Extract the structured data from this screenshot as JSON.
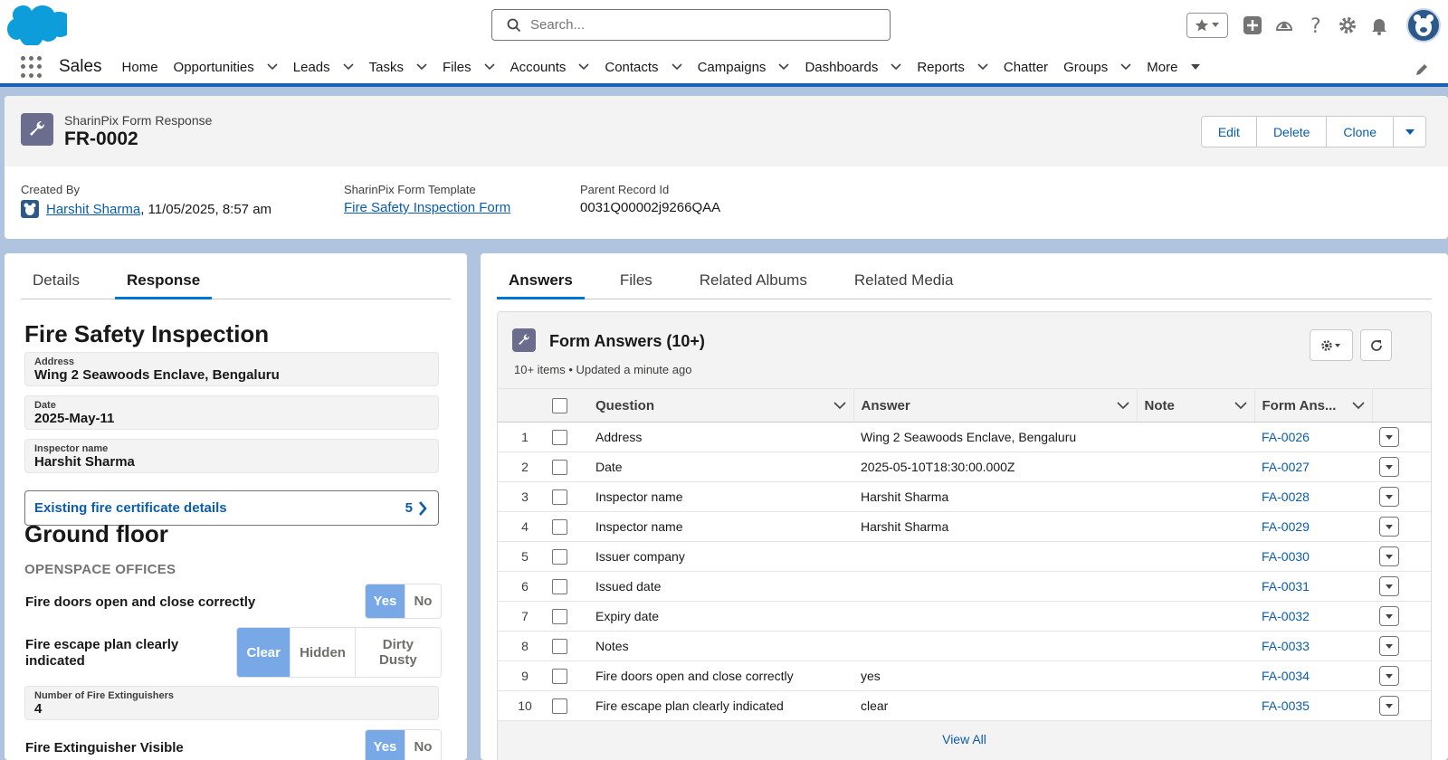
{
  "header": {
    "search_placeholder": "Search...",
    "app_name": "Sales",
    "nav": [
      {
        "label": "Home",
        "dropdown": false
      },
      {
        "label": "Opportunities",
        "dropdown": true
      },
      {
        "label": "Leads",
        "dropdown": true
      },
      {
        "label": "Tasks",
        "dropdown": true
      },
      {
        "label": "Files",
        "dropdown": true
      },
      {
        "label": "Accounts",
        "dropdown": true
      },
      {
        "label": "Contacts",
        "dropdown": true
      },
      {
        "label": "Campaigns",
        "dropdown": true
      },
      {
        "label": "Dashboards",
        "dropdown": true
      },
      {
        "label": "Reports",
        "dropdown": true
      },
      {
        "label": "Chatter",
        "dropdown": false
      },
      {
        "label": "Groups",
        "dropdown": true
      },
      {
        "label": "More",
        "dropdown": true
      }
    ]
  },
  "record": {
    "object_label": "SharinPix Form Response",
    "name": "FR-0002",
    "actions": {
      "edit": "Edit",
      "delete": "Delete",
      "clone": "Clone"
    },
    "created_by_label": "Created By",
    "created_by_user": "Harshit Sharma",
    "created_by_date": ", 11/05/2025, 8:57 am",
    "template_label": "SharinPix Form Template",
    "template_value": "Fire Safety Inspection Form",
    "parent_label": "Parent Record Id",
    "parent_value": "0031Q00002j9266QAA"
  },
  "left": {
    "tabs": [
      "Details",
      "Response"
    ],
    "active_tab": "Response",
    "form_title": "Fire Safety Inspection",
    "fields": [
      {
        "label": "Address",
        "value": "Wing 2 Seawoods Enclave, Bengaluru"
      },
      {
        "label": "Date",
        "value": "2025-May-11"
      },
      {
        "label": "Inspector name",
        "value": "Harshit Sharma"
      }
    ],
    "link_section": {
      "label": "Existing fire certificate details",
      "count": "5"
    },
    "section_title": "Ground floor",
    "section_subtitle": "OPENSPACE OFFICES",
    "q1": {
      "label": "Fire doors open and close correctly",
      "options": [
        "Yes",
        "No"
      ],
      "selected": "Yes"
    },
    "q2": {
      "label": "Fire escape plan clearly indicated",
      "options": [
        "Clear",
        "Hidden",
        "Dirty Dusty"
      ],
      "selected": "Clear"
    },
    "extinguishers": {
      "label": "Number of Fire Extinguishers",
      "value": "4"
    },
    "q3": {
      "label": "Fire Extinguisher Visible",
      "options": [
        "Yes",
        "No"
      ],
      "selected": "Yes"
    }
  },
  "right": {
    "tabs": [
      "Answers",
      "Files",
      "Related Albums",
      "Related Media"
    ],
    "active_tab": "Answers",
    "list_title": "Form Answers (10+)",
    "list_meta": "10+ items • Updated a minute ago",
    "columns": [
      "Question",
      "Answer",
      "Note",
      "Form Ans..."
    ],
    "rows": [
      {
        "n": "1",
        "question": "Address",
        "answer": "Wing 2 Seawoods Enclave, Bengaluru",
        "note": "",
        "id": "FA-0026"
      },
      {
        "n": "2",
        "question": "Date",
        "answer": "2025-05-10T18:30:00.000Z",
        "note": "",
        "id": "FA-0027"
      },
      {
        "n": "3",
        "question": "Inspector name",
        "answer": "Harshit Sharma",
        "note": "",
        "id": "FA-0028"
      },
      {
        "n": "4",
        "question": "Inspector name",
        "answer": "Harshit Sharma",
        "note": "",
        "id": "FA-0029"
      },
      {
        "n": "5",
        "question": "Issuer company",
        "answer": "",
        "note": "",
        "id": "FA-0030"
      },
      {
        "n": "6",
        "question": "Issued date",
        "answer": "",
        "note": "",
        "id": "FA-0031"
      },
      {
        "n": "7",
        "question": "Expiry date",
        "answer": "",
        "note": "",
        "id": "FA-0032"
      },
      {
        "n": "8",
        "question": "Notes",
        "answer": "",
        "note": "",
        "id": "FA-0033"
      },
      {
        "n": "9",
        "question": "Fire doors open and close correctly",
        "answer": "yes",
        "note": "",
        "id": "FA-0034"
      },
      {
        "n": "10",
        "question": "Fire escape plan clearly indicated",
        "answer": "clear",
        "note": "",
        "id": "FA-0035"
      }
    ],
    "view_all": "View All"
  },
  "colors": {
    "brand": "#0176d3",
    "link": "#0b5cab",
    "nav_border": "#1b5fb6",
    "segment_selected": "#78a9e6"
  }
}
